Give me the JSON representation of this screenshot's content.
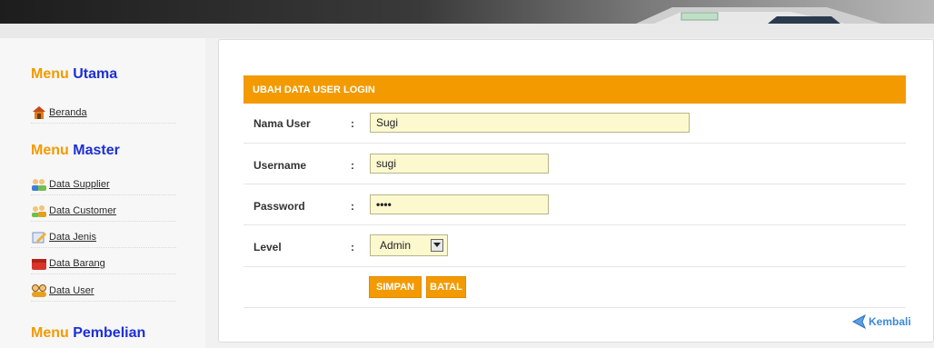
{
  "sidebar": {
    "sections": [
      {
        "title_a": "Menu",
        "title_b": "Utama"
      },
      {
        "title_a": "Menu",
        "title_b": "Master"
      },
      {
        "title_a": "Menu",
        "title_b": "Pembelian"
      }
    ],
    "items": [
      {
        "label": "Beranda",
        "icon": "home-icon"
      },
      {
        "label": "Data Supplier",
        "icon": "supplier-group-icon"
      },
      {
        "label": "Data Customer",
        "icon": "customer-group-icon"
      },
      {
        "label": "Data Jenis",
        "icon": "category-icon"
      },
      {
        "label": "Data Barang",
        "icon": "goods-box-icon"
      },
      {
        "label": "Data User",
        "icon": "users-icon"
      }
    ]
  },
  "form": {
    "title": "UBAH DATA USER LOGIN",
    "fields": [
      {
        "label": "Nama User",
        "value": "Sugi"
      },
      {
        "label": "Username",
        "value": "sugi"
      },
      {
        "label": "Password",
        "value": "••••"
      },
      {
        "label": "Level",
        "value": "Admin"
      }
    ],
    "colon": ":",
    "save_label": "SIMPAN",
    "cancel_label": "BATAL"
  },
  "back_link": {
    "label": "Kembali"
  },
  "colors": {
    "accent": "#f39a00",
    "menu_blue": "#1d2fd6",
    "input_bg": "#fdf9cf"
  }
}
